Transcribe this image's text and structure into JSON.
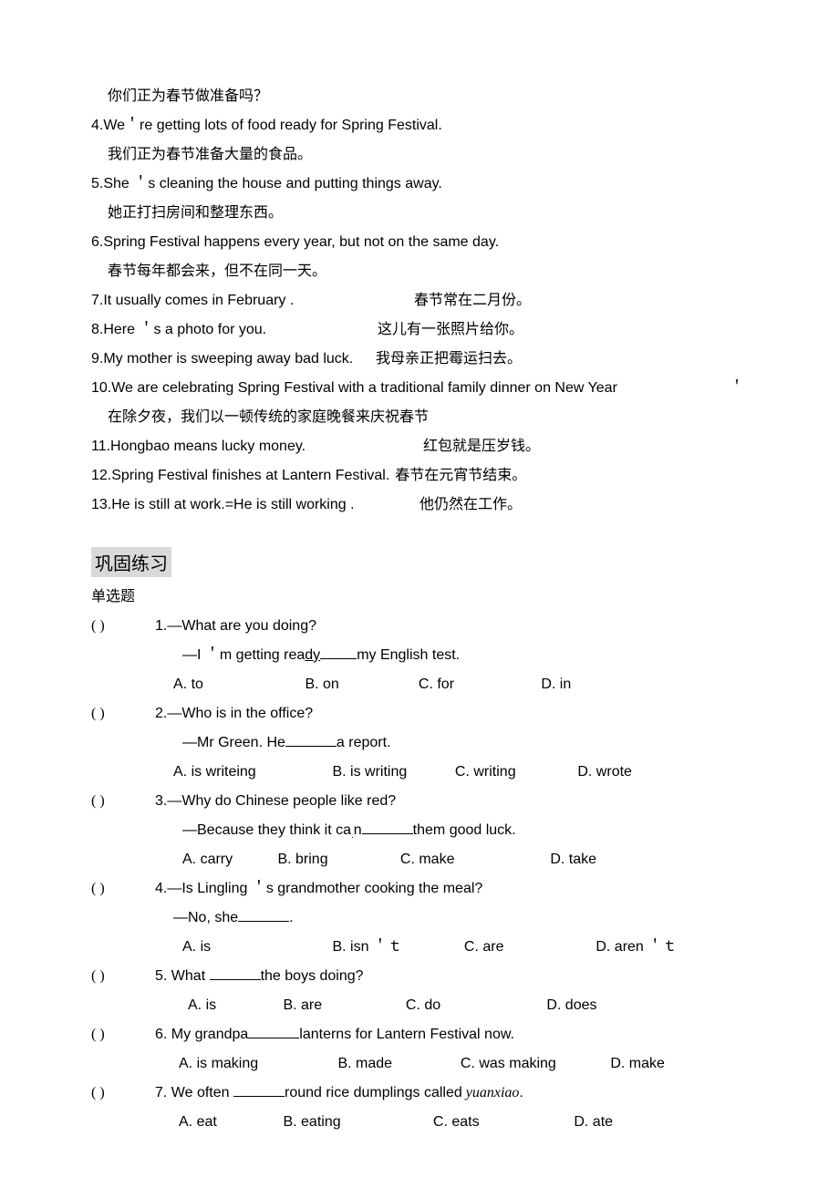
{
  "sentences": {
    "s3_cn": "你们正为春节做准备吗？",
    "s4_en": "4.We＇re getting lots of food ready for Spring Festival.",
    "s4_cn": "我们正为春节准备大量的食品。",
    "s5_en": "5.She ＇s cleaning the house and putting things away.",
    "s5_cn": "她正打扫房间和整理东西。",
    "s6_en": "6.Spring Festival happens every year, but not on the same day.",
    "s6_cn": "春节每年都会来，但不在同一天。",
    "s7_en": "7.It usually comes in February .",
    "s7_cn": "春节常在二月份。",
    "s8_en": "8.Here ＇s a photo for you.",
    "s8_cn": "这儿有一张照片给你。",
    "s9_en": "9.My mother is sweeping away bad luck.",
    "s9_cn": "我母亲正把霉运扫去。",
    "s10_en": "10.We are celebrating Spring Festival with a traditional family dinner on New Year",
    "s10_cn": "在除夕夜，我们以一顿传统的家庭晚餐来庆祝春节",
    "s10_trail": "＇",
    "s11_en": "11.Hongbao means lucky money.",
    "s11_cn": "红包就是压岁钱。",
    "s12_en": "12.Spring Festival finishes at Lantern Festival.",
    "s12_cn": "春节在元宵节结束。",
    "s13_en": "13.He is still at work.=He is still working .",
    "s13_cn": "他仍然在工作。"
  },
  "section": {
    "title": "巩固练习",
    "subtitle": "单选题"
  },
  "questions": {
    "q1": {
      "bracket": "(          )",
      "stem": "1.—What are you doing?",
      "sub_pre": "—I ＇m getting rea",
      "sub_u": "dy",
      "sub_post": "my English test.",
      "A": "A. to",
      "B": "B. on",
      "C": "C. for",
      "D": "D. in"
    },
    "q2": {
      "bracket": "(          )",
      "stem": "2.—Who is in the office?",
      "sub_pre": "—Mr Green. He",
      "sub_post": "a report.",
      "A": "A. is writeing",
      "B": "B. is writing",
      "C": "C. writing",
      "D": "D. wrote"
    },
    "q3": {
      "bracket": "(          )",
      "stem": "3.—Why do Chinese people like red?",
      "sub_pre": "—Because they think it ca",
      "sub_mid": "n",
      "sub_post": "them good luck.",
      "A": "A. carry",
      "B": "B. bring",
      "C": "C. make",
      "D": "D. take"
    },
    "q4": {
      "bracket": "(          )",
      "stem": "4.—Is Lingling   ＇s grandmother cooking the meal?",
      "sub_pre": "—No, she",
      "sub_post": ".",
      "A": "A. is",
      "B": "B. isn ＇ｔ",
      "C": "C. are",
      "D": "D. aren ＇ｔ"
    },
    "q5": {
      "bracket": "(          )",
      "stem_pre": "5. What ",
      "stem_post": "the boys doing?",
      "A": "A. is",
      "B": "B. are",
      "C": "C. do",
      "D": "D. does"
    },
    "q6": {
      "bracket": "(          )",
      "stem_pre": "6. My grandpa",
      "stem_post": "lanterns for Lantern Festival now.",
      "A": "A. is making",
      "B": "B. made",
      "C": "C. was making",
      "D": "D. make"
    },
    "q7": {
      "bracket": "(          )",
      "stem_pre": "7. We often ",
      "stem_post": "round rice dumplings called",
      "stem_tail": " yuanxiao",
      "stem_dot": ".",
      "A": "A. eat",
      "B": "B. eating",
      "C": "C. eats",
      "D": "D. ate"
    }
  }
}
